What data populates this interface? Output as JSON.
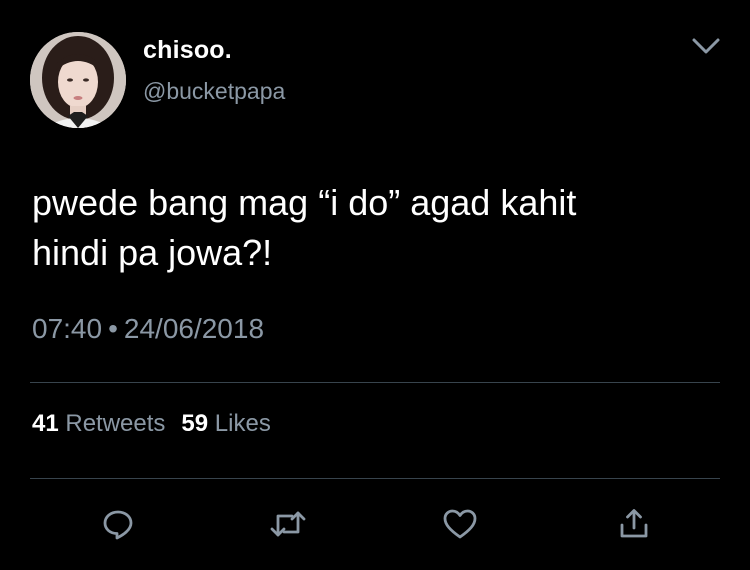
{
  "tweet": {
    "display_name": "chisoo.",
    "handle": "@bucketpapa",
    "text": "pwede bang mag “i do” agad kahit\nhindi pa jowa?!",
    "time": "07:40",
    "separator": "•",
    "date": "24/06/2018",
    "retweets_count": "41",
    "retweets_label": "Retweets",
    "likes_count": "59",
    "likes_label": "Likes"
  },
  "icons": {
    "menu": "chevron-down-icon",
    "reply": "reply-icon",
    "retweet": "retweet-icon",
    "like": "heart-icon",
    "share": "share-icon"
  },
  "colors": {
    "background": "#000000",
    "text": "#ffffff",
    "secondary_text": "#8b98a5",
    "divider": "#38444d"
  }
}
